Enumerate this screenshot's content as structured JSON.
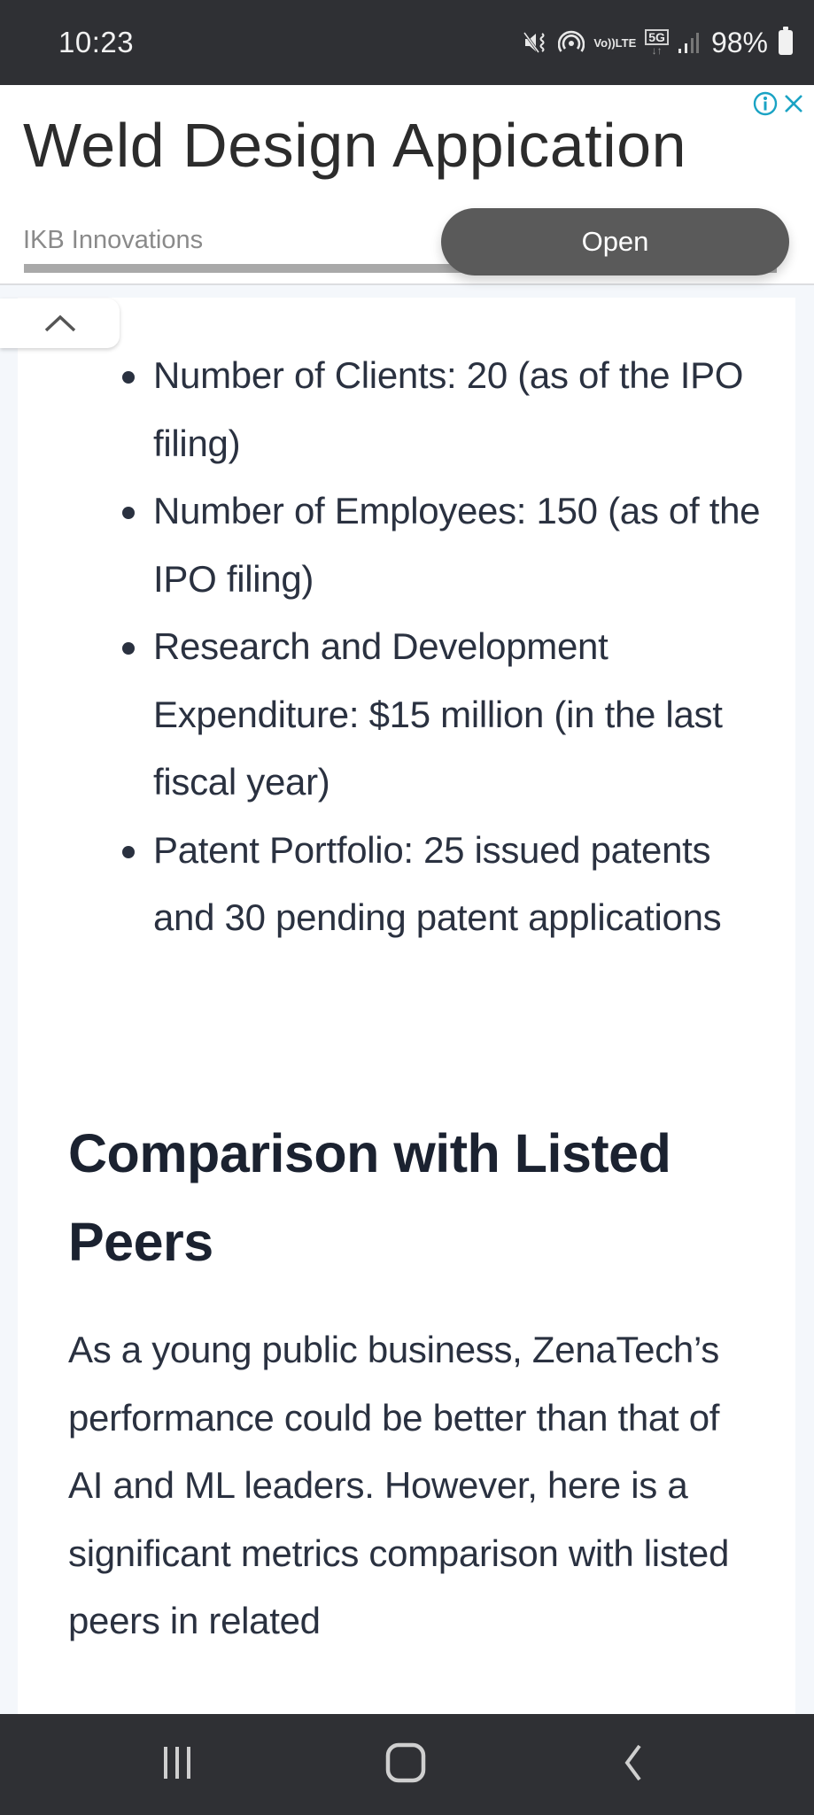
{
  "status_bar": {
    "time": "10:23",
    "icons": [
      "mute-vibrate-icon",
      "hotspot-icon",
      "volte-icon",
      "5g-icon",
      "signal-icon"
    ],
    "volte_label_top": "Vo))",
    "volte_label_bottom": "LTE",
    "network_label": "5G",
    "network_arrows": "↓↑",
    "battery_percent": "98%"
  },
  "ad": {
    "title": "Weld Design Appication",
    "advertiser": "IKB Innovations",
    "cta_label": "Open",
    "info_icon": "info-icon",
    "close_icon": "close-icon",
    "accent_color": "#1aa3c4"
  },
  "collapse_tab": {
    "icon": "chevron-up-icon"
  },
  "article": {
    "bullets": [
      {
        "text": "Number of Clients: 20 (as of the IPO filing)"
      },
      {
        "text": "Number of Employees: 150 (as of the IPO filing)"
      },
      {
        "text": "Research and Development Expenditure: $15 million (in the last fiscal year)"
      },
      {
        "text": "Patent Portfolio: 25 issued patents and 30 pending patent applications"
      }
    ],
    "section_heading": "Comparison with Listed Peers",
    "paragraph": "As a young public business, ZenaTech’s performance could be better than that of AI and ML leaders. However, here is a significant metrics comparison with listed peers in related"
  },
  "nav_bar": {
    "recents_icon": "recents-icon",
    "home_icon": "home-icon",
    "back_icon": "back-icon"
  }
}
